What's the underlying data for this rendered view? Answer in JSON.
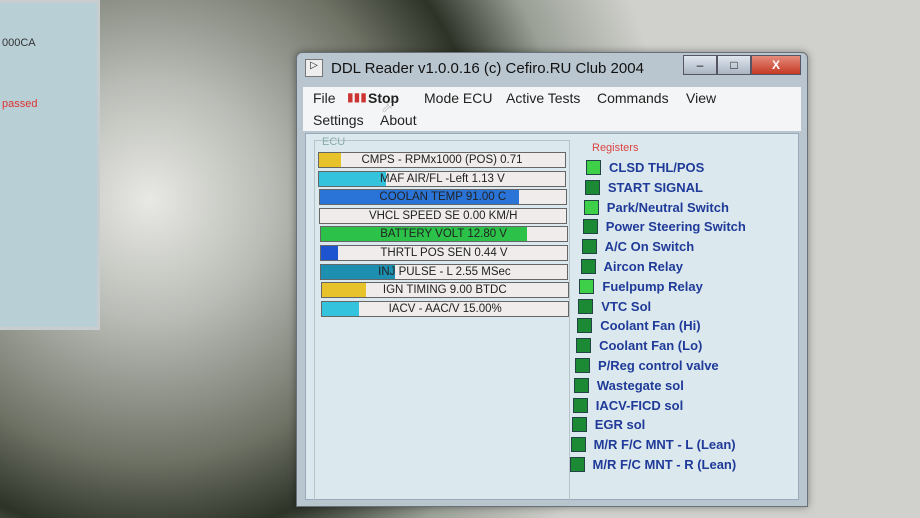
{
  "background_window": {
    "lines": [
      "000CA",
      "passed"
    ]
  },
  "window": {
    "title": "DDL Reader v1.0.0.16 (c)  Cefiro.RU Club 2004",
    "controls": {
      "minimize": "–",
      "maximize": "□",
      "close": "X"
    }
  },
  "menu": {
    "items": [
      "File",
      "Stop",
      "Mode ECU",
      "Active Tests",
      "Commands",
      "View",
      "Settings",
      "About"
    ]
  },
  "ecu": {
    "label": "ECU",
    "gauges": [
      {
        "text": "CMPS - RPMx1000 (POS) 0.71",
        "fill": 0.09,
        "color": "#e8c22a"
      },
      {
        "text": "MAF AIR/FL -Left 1.13 V",
        "fill": 0.27,
        "color": "#33c3dc"
      },
      {
        "text": "COOLAN TEMP 91.00 C",
        "fill": 0.81,
        "color": "#2a74d8"
      },
      {
        "text": "VHCL SPEED SE 0.00 KM/H",
        "fill": 0.0,
        "color": "#33c3dc"
      },
      {
        "text": "BATTERY VOLT 12.80 V",
        "fill": 0.84,
        "color": "#2cc24a"
      },
      {
        "text": "THRTL POS SEN 0.44 V",
        "fill": 0.07,
        "color": "#1e54d0"
      },
      {
        "text": "INJ PULSE - L 2.55 MSec",
        "fill": 0.3,
        "color": "#1d8fb0"
      },
      {
        "text": "IGN TIMING 9.00 BTDC",
        "fill": 0.18,
        "color": "#e8c22a"
      },
      {
        "text": "IACV - AAC/V 15.00%",
        "fill": 0.15,
        "color": "#33c3dc"
      }
    ]
  },
  "registers": {
    "label": "Registers",
    "on_color": "#3fd04a",
    "off_color": "#1c8a34",
    "items": [
      {
        "label": "CLSD THL/POS",
        "on": true
      },
      {
        "label": "START SIGNAL",
        "on": false
      },
      {
        "label": "Park/Neutral Switch",
        "on": true
      },
      {
        "label": "Power Steering Switch",
        "on": false
      },
      {
        "label": "A/C On Switch",
        "on": false
      },
      {
        "label": "Aircon Relay",
        "on": false
      },
      {
        "label": "Fuelpump Relay",
        "on": true
      },
      {
        "label": "VTC Sol",
        "on": false
      },
      {
        "label": "Coolant Fan (Hi)",
        "on": false
      },
      {
        "label": "Coolant Fan (Lo)",
        "on": false
      },
      {
        "label": "P/Reg control valve",
        "on": false
      },
      {
        "label": "Wastegate sol",
        "on": false
      },
      {
        "label": "IACV-FICD sol",
        "on": false
      },
      {
        "label": "EGR sol",
        "on": false
      },
      {
        "label": "M/R F/C MNT - L (Lean)",
        "on": false
      },
      {
        "label": "M/R F/C MNT - R (Lean)",
        "on": false
      }
    ]
  }
}
